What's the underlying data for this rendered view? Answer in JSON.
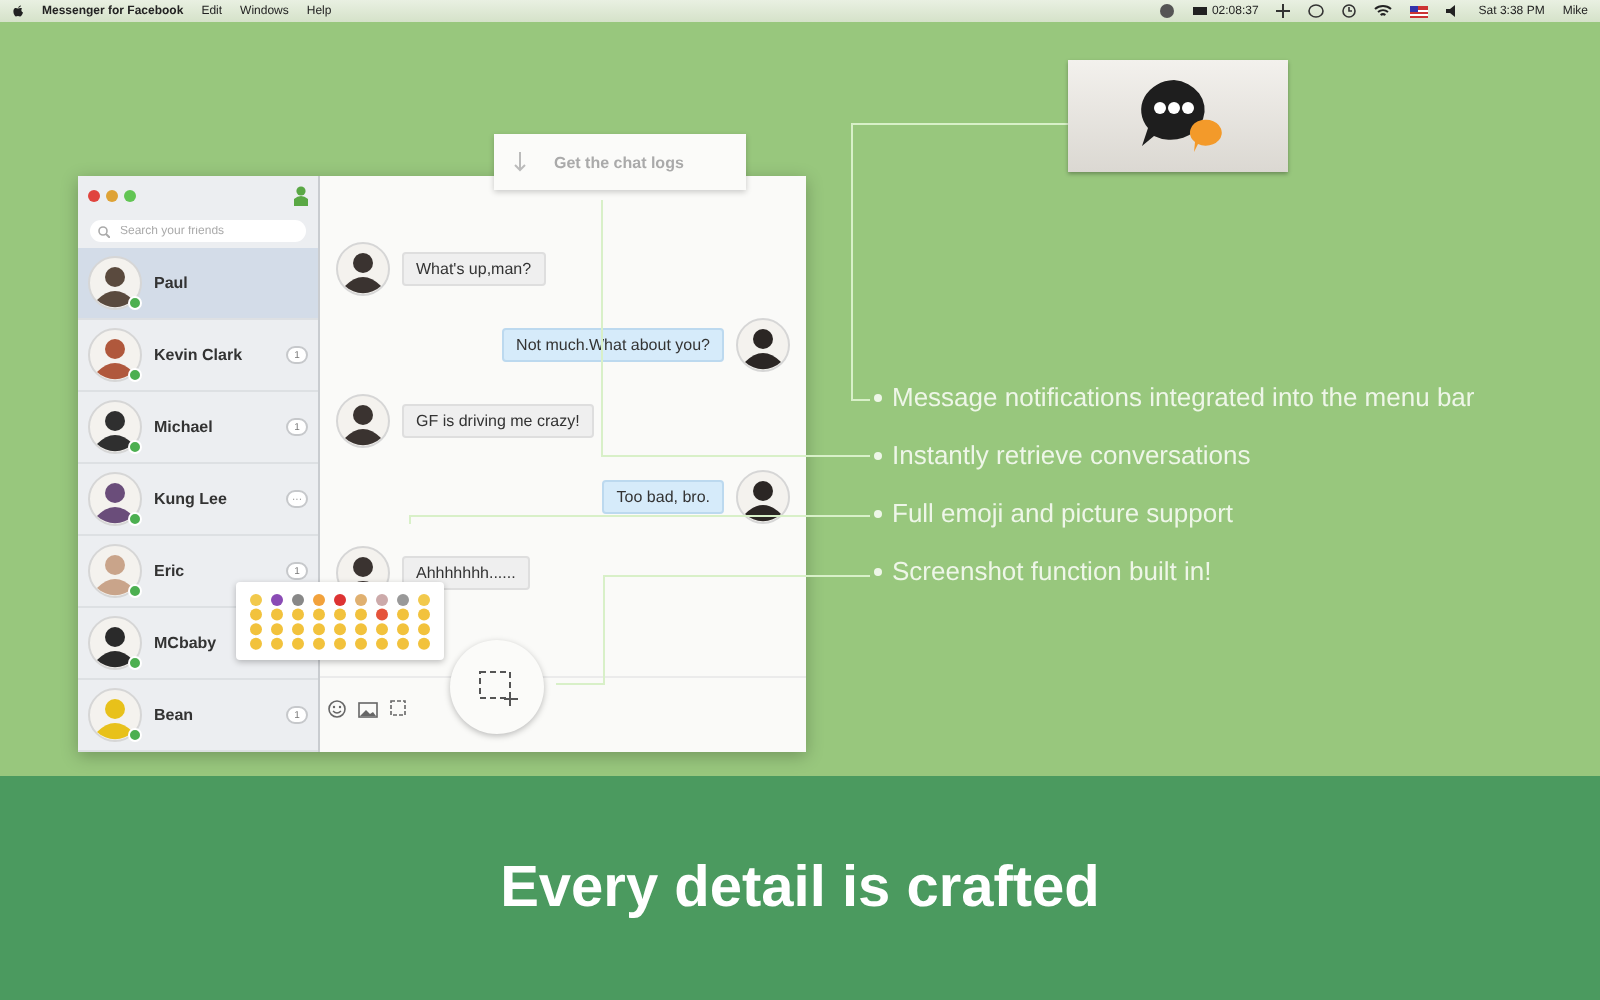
{
  "menu_bar": {
    "app": "Messenger for Facebook",
    "menus": [
      "Edit",
      "Windows",
      "Help"
    ],
    "timer": "02:08:37",
    "clock": "Sat 3:38 PM",
    "user": "Mike"
  },
  "menu_bar_card": {
    "kind": "picture"
  },
  "sidebar": {
    "search": {
      "placeholder": "Search your friends"
    },
    "contacts": [
      {
        "name": "Paul",
        "selected": true
      },
      {
        "name": "Kevin Clark",
        "selected": false,
        "badge": "1"
      },
      {
        "name": "Michael",
        "selected": false,
        "badge": "1"
      },
      {
        "name": "Kung Lee",
        "selected": false,
        "badge": "···"
      },
      {
        "name": "Eric",
        "selected": false,
        "badge": "1"
      },
      {
        "name": "MCbaby",
        "selected": false
      },
      {
        "name": "Bean",
        "selected": false,
        "badge": "1"
      }
    ]
  },
  "chat": {
    "logs_button": "Get the chat logs",
    "messages": [
      {
        "kind": "received",
        "text": "What's up,man?"
      },
      {
        "kind": "sent",
        "text": "Not much.What about you?"
      },
      {
        "kind": "received",
        "text": "GF is driving me crazy!"
      },
      {
        "kind": "sent",
        "text": "Too bad, bro."
      },
      {
        "kind": "received",
        "text": "Ahhhhhhh......"
      }
    ]
  },
  "features": [
    "Message notifications integrated into the menu bar",
    "Instantly retrieve conversations",
    "Full emoji and picture support",
    "Screenshot function built in!"
  ],
  "banner": "Every detail is crafted"
}
